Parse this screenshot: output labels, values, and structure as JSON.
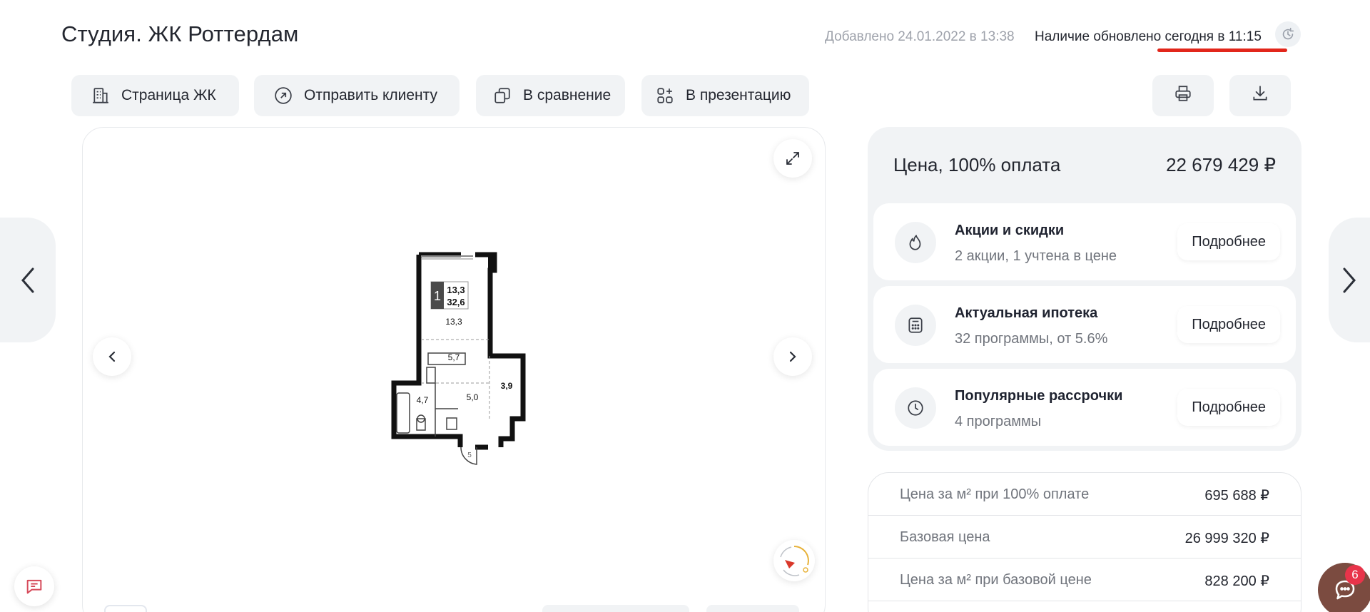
{
  "header": {
    "title": "Студия. ЖК Роттердам",
    "added": "Добавлено 24.01.2022 в 13:38",
    "updated": "Наличие обновлено сегодня в 11:15"
  },
  "toolbar": {
    "complex_page": "Страница ЖК",
    "send_to_client": "Отправить клиенту",
    "compare": "В сравнение",
    "presentation": "В презентацию"
  },
  "plan": {
    "rooms": "1",
    "living_area": "13,3",
    "total_area": "32,6",
    "room_main": "13,3",
    "room_hall": "5,7",
    "room_balcony": "3,9",
    "room_bath": "4,7",
    "room_corridor": "5,0",
    "room_entry": "5"
  },
  "price": {
    "title": "Цена, 100% оплата",
    "value": "22 679 429 ₽",
    "offers": [
      {
        "title": "Акции и скидки",
        "subtitle": "2 акции, 1 учтена в цене",
        "more": "Подробнее",
        "icon": "fire-icon"
      },
      {
        "title": "Актуальная ипотека",
        "subtitle": "32 программы, от 5.6%",
        "more": "Подробнее",
        "icon": "calculator-icon"
      },
      {
        "title": "Популярные рассрочки",
        "subtitle": "4 программы",
        "more": "Подробнее",
        "icon": "clock-icon"
      }
    ]
  },
  "details": [
    {
      "label": "Цена за м² при 100% оплате",
      "value": "695 688 ₽"
    },
    {
      "label": "Базовая цена",
      "value": "26 999 320 ₽"
    },
    {
      "label": "Цена за м² при базовой цене",
      "value": "828 200 ₽"
    }
  ],
  "chat": {
    "badge": "6"
  },
  "colors": {
    "accent_red": "#e2261b",
    "panel_bg": "#f1f3f5",
    "chat_brown": "#7b4b40",
    "badge_pink": "#e8344a"
  }
}
